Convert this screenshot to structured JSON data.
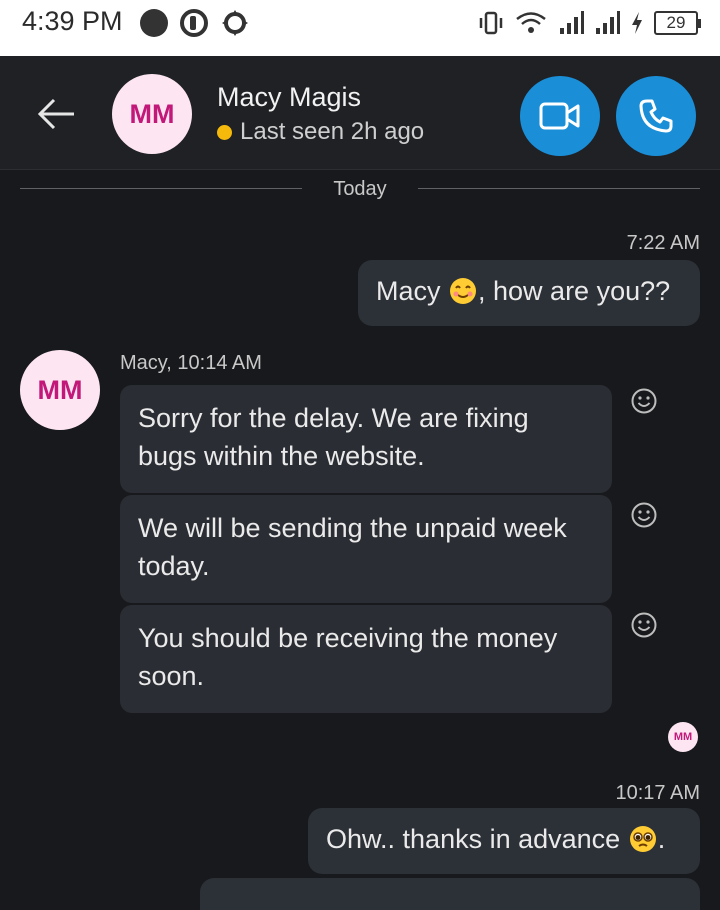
{
  "status_bar": {
    "time": "4:39 PM",
    "battery": "29",
    "icons": [
      "notification-dot-icon",
      "app-icon",
      "settings-badge-icon",
      "vibrate-icon",
      "wifi-icon",
      "signal-icon",
      "signal-icon",
      "charging-icon",
      "battery-icon"
    ]
  },
  "header": {
    "back_icon": "arrow-left-icon",
    "avatar_initials": "MM",
    "contact_name": "Macy Magis",
    "status_text": "Last seen 2h ago",
    "status_color": "#f5b90b",
    "video_call_icon": "video-camera-icon",
    "audio_call_icon": "phone-icon",
    "accent_color": "#1a8fd8"
  },
  "conversation": {
    "date_divider": "Today",
    "messages": [
      {
        "direction": "out",
        "time": "7:22 AM",
        "text_before": "Macy ",
        "emoji": "smiling-face-emoji",
        "text_after": ", how are you??"
      },
      {
        "direction": "in",
        "sender_line": "Macy, 10:14 AM",
        "avatar_initials": "MM",
        "text": "Sorry for the delay. We are fixing bugs within the website.",
        "reaction_icon": "smiley-react-icon"
      },
      {
        "direction": "in",
        "text": "We will be sending the unpaid week today.",
        "reaction_icon": "smiley-react-icon"
      },
      {
        "direction": "in",
        "text": "You should be receiving the money soon.",
        "reaction_icon": "smiley-react-icon"
      },
      {
        "direction": "read_receipt",
        "avatar_initials": "MM"
      },
      {
        "direction": "out",
        "time": "10:17 AM",
        "text_before": "Ohw.. thanks in advance ",
        "emoji": "pleading-face-emoji",
        "text_after": "."
      }
    ]
  }
}
